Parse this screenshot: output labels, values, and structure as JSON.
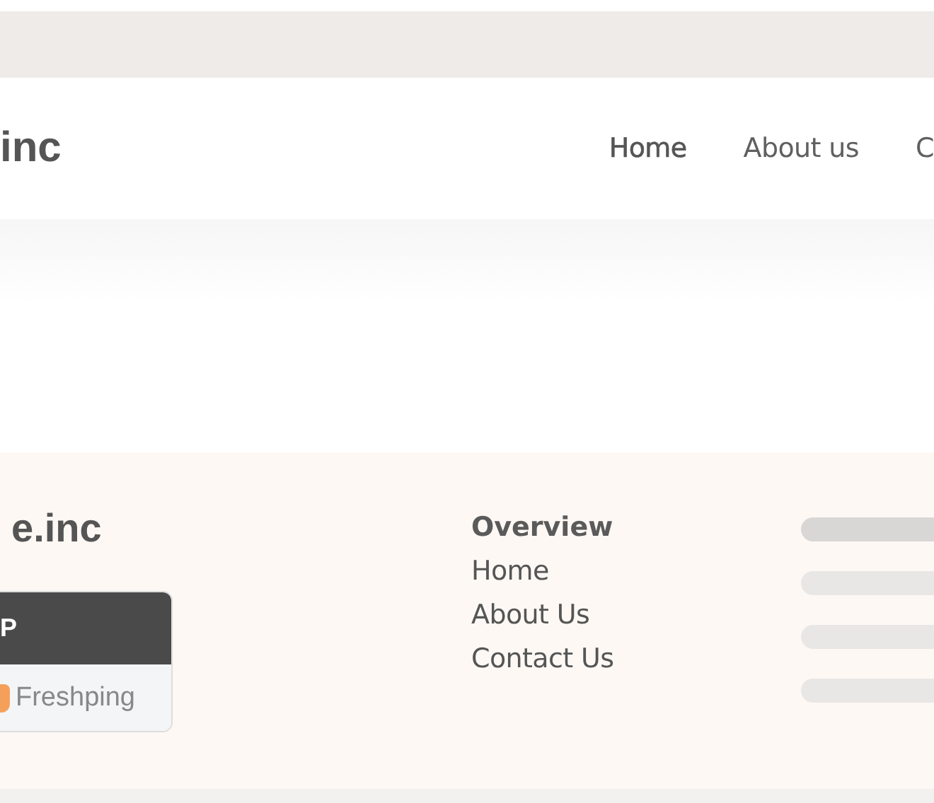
{
  "header": {
    "logo": "inc",
    "nav": [
      {
        "label": "Home",
        "selected": true
      },
      {
        "label": "About us",
        "selected": false
      },
      {
        "label": "C",
        "selected": false
      }
    ]
  },
  "footer": {
    "logo": "e.inc",
    "status_badge": {
      "title": "P",
      "provider": "Freshping"
    },
    "links": {
      "heading": "Overview",
      "items": [
        "Home",
        "About Us",
        "Contact Us"
      ]
    },
    "skeleton": [
      {
        "color": "#d8d7d6"
      },
      {
        "color": "#e9e7e5"
      },
      {
        "color": "#e9e7e5"
      },
      {
        "color": "#e9e7e5"
      }
    ]
  }
}
